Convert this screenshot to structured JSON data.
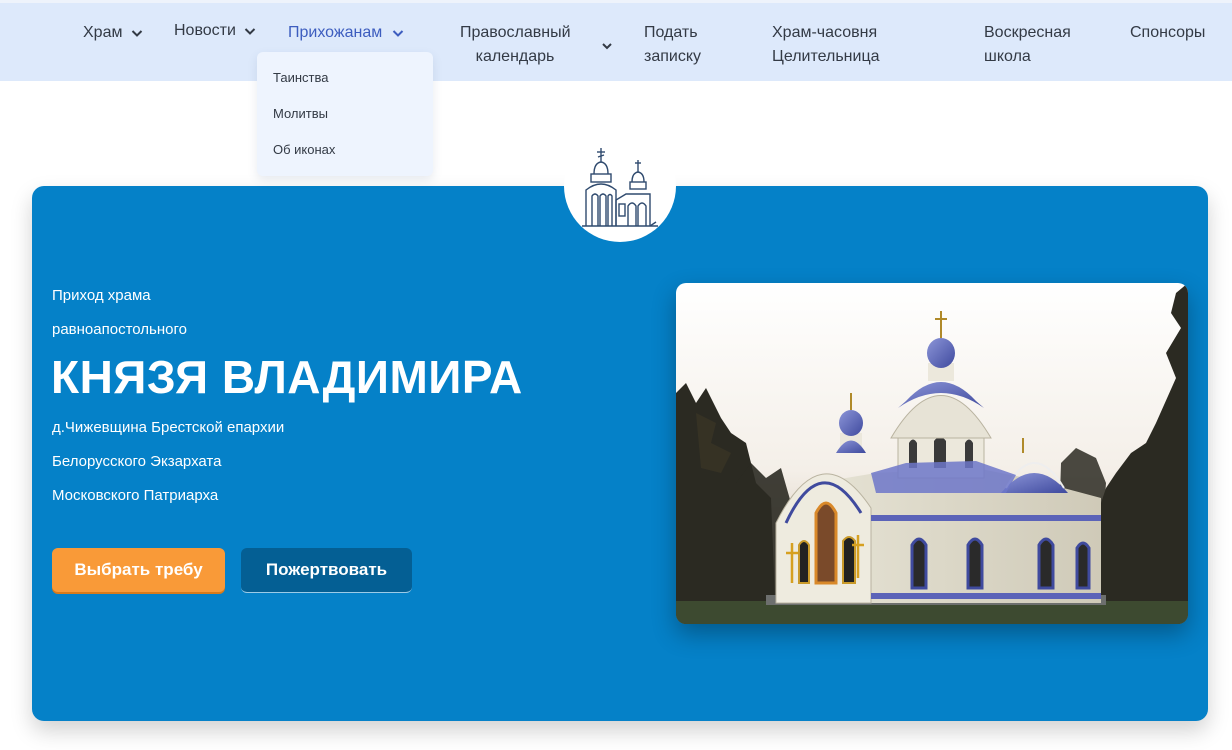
{
  "nav": {
    "items": [
      {
        "label": "Храм",
        "has_dropdown": true
      },
      {
        "label": "Новости",
        "has_dropdown": true
      },
      {
        "label": "Прихожанам",
        "has_dropdown": true,
        "active": true
      },
      {
        "label": "Православный календарь",
        "has_dropdown": true
      },
      {
        "label": "Подать записку",
        "has_dropdown": false
      },
      {
        "label": "Храм-часовня Целительница",
        "has_dropdown": false
      },
      {
        "label": "Воскресная школа",
        "has_dropdown": false
      },
      {
        "label": "Спонсоры",
        "has_dropdown": false
      }
    ],
    "calendar_line1": "Православный",
    "calendar_line2": "календарь",
    "note_line1": "Подать",
    "note_line2": "записку",
    "chapel_line1": "Храм-часовня",
    "chapel_line2": "Целительница",
    "school_line1": "Воскресная",
    "school_line2": "школа"
  },
  "dropdown": {
    "items": [
      "Таинства",
      "Молитвы",
      "Об иконах"
    ]
  },
  "hero": {
    "line1": "Приход храма",
    "line2": "равноапостольного",
    "title": "КНЯЗЯ ВЛАДИМИРА",
    "line3": "д.Чижевщина Брестской епархии",
    "line4": "Белорусского Экзархата",
    "line5": "Московского Патриарха",
    "btn_primary": "Выбрать требу",
    "btn_secondary": "Пожертвовать"
  },
  "colors": {
    "nav_bg": "#dde9fb",
    "hero_bg": "#0581c8",
    "accent_orange": "#f99a38",
    "accent_dark_blue": "#045f94",
    "active_link": "#3d5dbf"
  },
  "icons": [
    "chevron-down-icon",
    "church-logo-icon"
  ]
}
